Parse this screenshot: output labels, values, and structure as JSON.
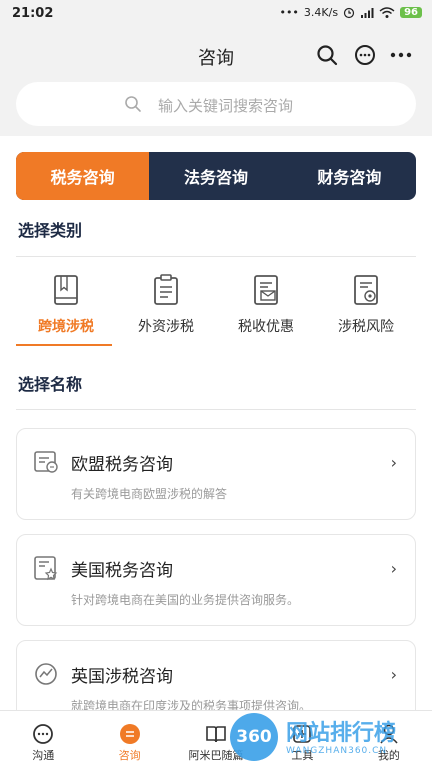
{
  "status": {
    "time": "21:02",
    "speed": "3.4K/s",
    "battery": "96"
  },
  "nav": {
    "title": "咨询"
  },
  "search": {
    "placeholder": "输入关键词搜索咨询"
  },
  "segments": [
    {
      "label": "税务咨询",
      "active": true
    },
    {
      "label": "法务咨询",
      "active": false
    },
    {
      "label": "财务咨询",
      "active": false
    }
  ],
  "sections": {
    "category": "选择类别",
    "name": "选择名称"
  },
  "categories": [
    {
      "label": "跨境涉税",
      "active": true,
      "icon": "book-icon"
    },
    {
      "label": "外资涉税",
      "active": false,
      "icon": "clipboard-icon"
    },
    {
      "label": "税收优惠",
      "active": false,
      "icon": "document-mail-icon"
    },
    {
      "label": "涉税风险",
      "active": false,
      "icon": "document-shield-icon"
    }
  ],
  "cards": [
    {
      "title": "欧盟税务咨询",
      "desc": "有关跨境电商欧盟涉税的解答",
      "icon": "chat-card-icon"
    },
    {
      "title": "美国税务咨询",
      "desc": "针对跨境电商在美国的业务提供咨询服务。",
      "icon": "star-doc-icon"
    },
    {
      "title": "英国涉税咨询",
      "desc": "就跨境电商在印度涉及的税务事项提供咨询。",
      "icon": "refresh-chart-icon"
    }
  ],
  "tabs": [
    {
      "label": "沟通",
      "icon": "chat-icon",
      "active": false
    },
    {
      "label": "咨询",
      "icon": "consult-icon",
      "active": true
    },
    {
      "label": "阿米巴随篇",
      "icon": "open-book-icon",
      "active": false
    },
    {
      "label": "工具",
      "icon": "tools-icon",
      "active": false
    },
    {
      "label": "我的",
      "icon": "person-icon",
      "active": false
    }
  ],
  "watermark": {
    "badge": "360",
    "text": "网站排行榜",
    "sub": "WANGZHAN360.CN"
  },
  "colors": {
    "accent": "#f07a26",
    "navy": "#22304a",
    "watermark": "#3aa0e8"
  }
}
